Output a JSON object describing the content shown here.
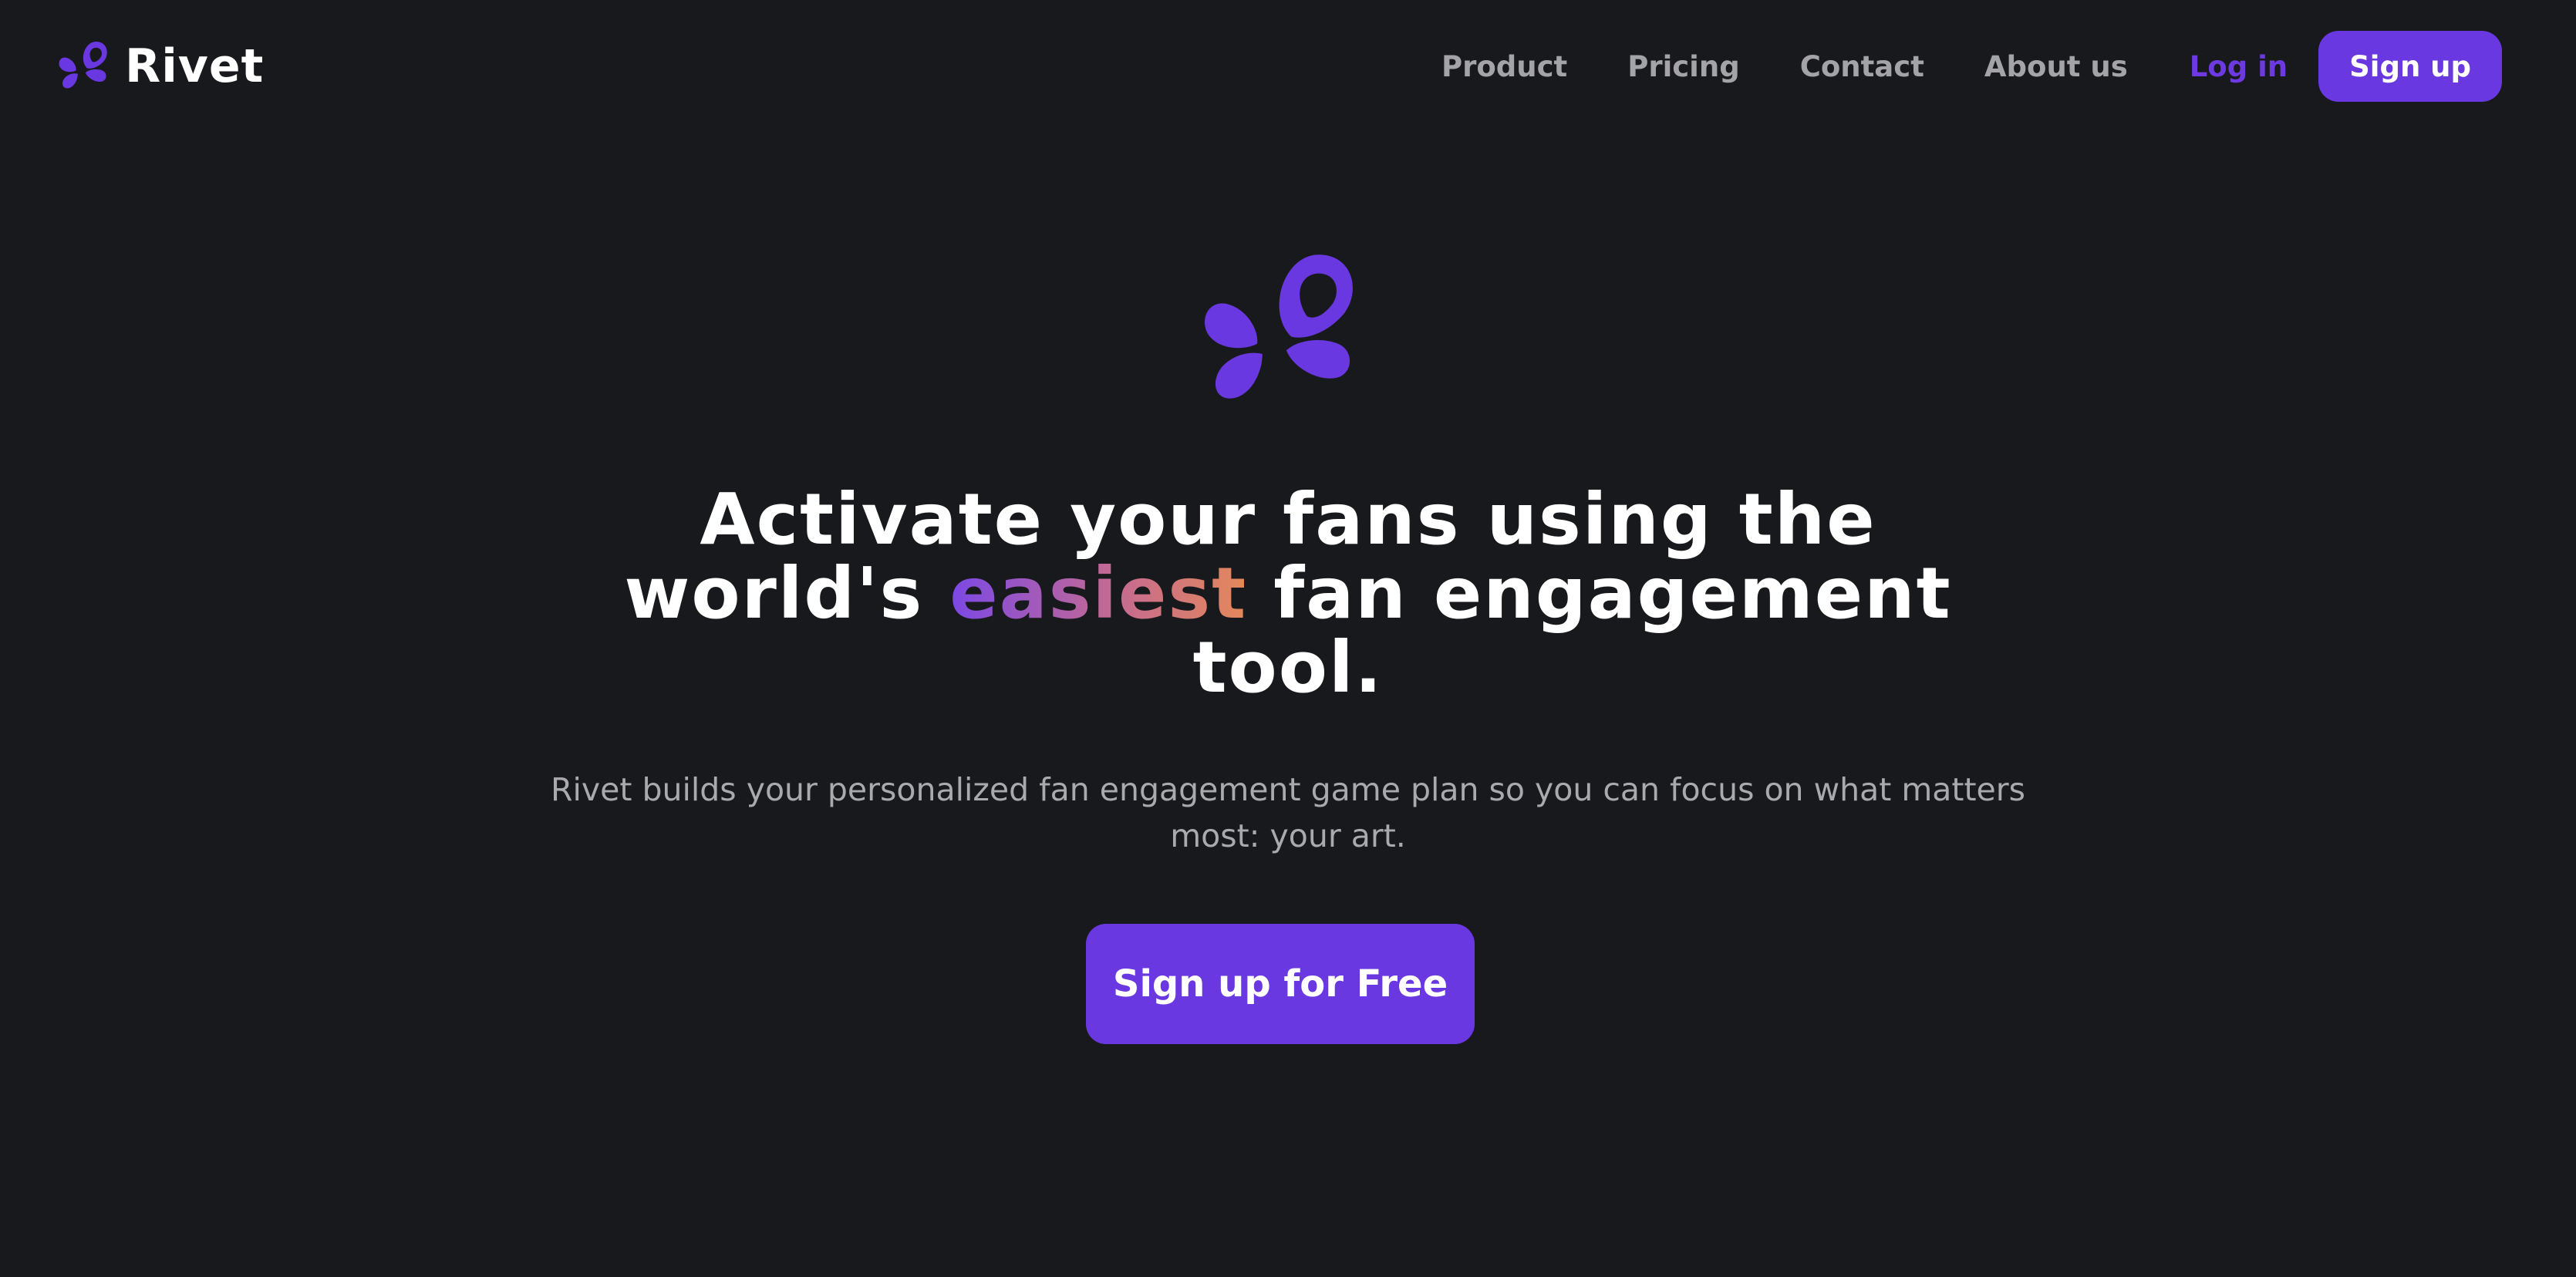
{
  "brand": {
    "name": "Rivet",
    "logo_icon": "rivet-petal-logo-icon",
    "color": "#6a38e0"
  },
  "nav": {
    "links": [
      {
        "label": "Product"
      },
      {
        "label": "Pricing"
      },
      {
        "label": "Contact"
      },
      {
        "label": "About us"
      }
    ],
    "login_label": "Log in",
    "signup_label": "Sign up"
  },
  "hero": {
    "logo_icon": "rivet-petal-logo-icon",
    "headline": {
      "line1": "Activate your fans using the",
      "line2_before": "world's ",
      "line2_accent": "easiest",
      "line2_after": " fan engagement",
      "line3": "tool."
    },
    "subtitle": {
      "line1": "Rivet builds your personalized fan engagement game plan so you can focus on what matters",
      "line2": "most: your art."
    },
    "cta_label": "Sign up for Free"
  },
  "colors": {
    "background": "#18191c",
    "accent": "#6a38e0",
    "nav_text": "#a3a3a8",
    "gradient": [
      "#7b48e6",
      "#c46a92",
      "#e4885a"
    ]
  }
}
